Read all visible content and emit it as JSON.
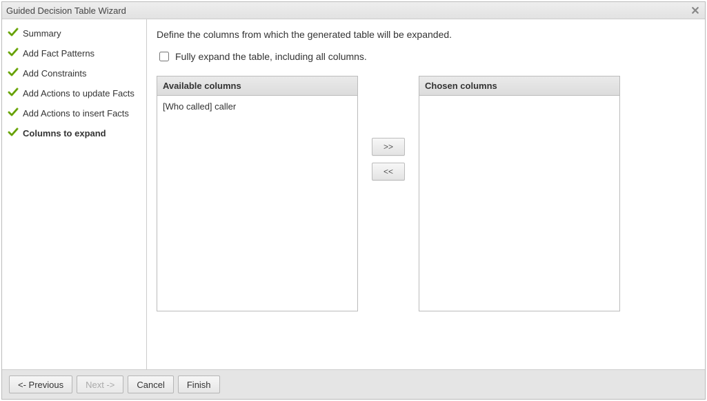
{
  "window": {
    "title": "Guided Decision Table Wizard"
  },
  "sidebar": {
    "steps": [
      {
        "label": "Summary"
      },
      {
        "label": "Add Fact Patterns"
      },
      {
        "label": "Add Constraints"
      },
      {
        "label": "Add Actions to update Facts"
      },
      {
        "label": "Add Actions to insert Facts"
      },
      {
        "label": "Columns to expand"
      }
    ]
  },
  "main": {
    "instruction": "Define the columns from which the generated table will be expanded.",
    "fully_expand_label": "Fully expand the table, including all columns.",
    "available_header": "Available columns",
    "chosen_header": "Chosen columns",
    "available_items": [
      "[Who called] caller"
    ],
    "chosen_items": [],
    "btn_add": ">>",
    "btn_remove": "<<"
  },
  "footer": {
    "previous": "<- Previous",
    "next": "Next ->",
    "cancel": "Cancel",
    "finish": "Finish"
  }
}
